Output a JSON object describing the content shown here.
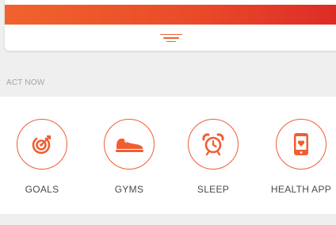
{
  "act_now": {
    "heading": "ACT NOW",
    "items": [
      {
        "label": "GOALS",
        "icon": "target-icon"
      },
      {
        "label": "GYMS",
        "icon": "sneaker-icon"
      },
      {
        "label": "SLEEP",
        "icon": "alarm-clock-icon"
      },
      {
        "label": "HEALTH APP",
        "icon": "phone-heart-icon"
      }
    ]
  },
  "colors": {
    "accent": "#ef5e31",
    "gradient_start": "#f0632d",
    "gradient_end": "#dc2a26",
    "background": "#efeff0"
  }
}
